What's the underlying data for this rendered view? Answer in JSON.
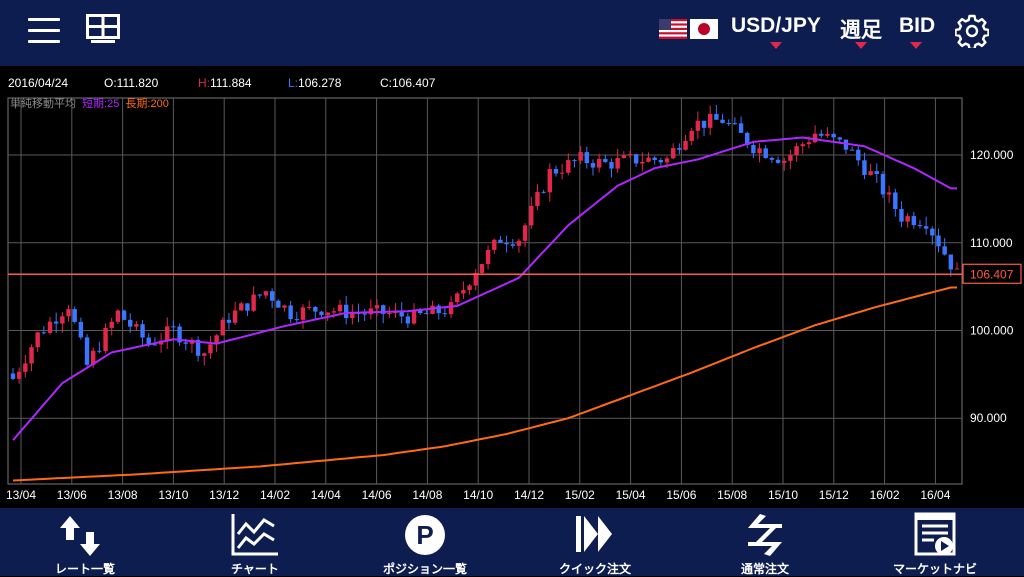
{
  "toolbar": {
    "pair": "USD/JPY",
    "period": "週足",
    "price_type": "BID",
    "flags": [
      "us-flag-icon",
      "jp-flag-icon"
    ]
  },
  "ohlc": {
    "date": "2016/04/24",
    "open": "O:111.820",
    "high_prefix": "H:",
    "high_value": "111.884",
    "low_prefix": "L:",
    "low_value": "106.278",
    "close": "C:106.407"
  },
  "indicator": {
    "name": "単純移動平均",
    "short": "短期:25",
    "long": "長期:200"
  },
  "colors": {
    "up": "#e2284a",
    "down": "#3a76ff",
    "short_ma": "#b026ff",
    "long_ma": "#ff6a14",
    "current_line": "#ff5a45"
  },
  "bottom_nav": [
    {
      "label": "レート一覧",
      "icon": "rate-list-icon"
    },
    {
      "label": "チャート",
      "icon": "chart-icon"
    },
    {
      "label": "ポジション一覧",
      "icon": "position-icon"
    },
    {
      "label": "クイック注文",
      "icon": "quick-order-icon"
    },
    {
      "label": "通常注文",
      "icon": "normal-order-icon"
    },
    {
      "label": "マーケットナビ",
      "icon": "market-navi-icon"
    }
  ],
  "chart_data": {
    "type": "candlestick",
    "title": "",
    "x_labels": [
      "13/04",
      "13/06",
      "13/08",
      "13/10",
      "13/12",
      "14/02",
      "14/04",
      "14/06",
      "14/08",
      "14/10",
      "14/12",
      "15/02",
      "15/04",
      "15/06",
      "15/08",
      "15/10",
      "15/12",
      "16/02",
      "16/04"
    ],
    "y_ticks": [
      "90.000",
      "100.000",
      "110.000",
      "120.000"
    ],
    "ylim": [
      82.5,
      126.5
    ],
    "current_price": "106.407",
    "current_value": 106.407,
    "grid": true,
    "close_path": [
      [
        0,
        94.5
      ],
      [
        4,
        99.5
      ],
      [
        9,
        103
      ],
      [
        12,
        96
      ],
      [
        17,
        102
      ],
      [
        22,
        98.5
      ],
      [
        26,
        100
      ],
      [
        31,
        97.5
      ],
      [
        35,
        101.5
      ],
      [
        41,
        104.5
      ],
      [
        45,
        102
      ],
      [
        50,
        102.5
      ],
      [
        55,
        102
      ],
      [
        60,
        102
      ],
      [
        65,
        101.5
      ],
      [
        71,
        102.5
      ],
      [
        75,
        107
      ],
      [
        79,
        110.5
      ],
      [
        82,
        110.5
      ],
      [
        87,
        118
      ],
      [
        92,
        119.5
      ],
      [
        96,
        119
      ],
      [
        101,
        119.5
      ],
      [
        106,
        119.5
      ],
      [
        110,
        123.5
      ],
      [
        115,
        124
      ],
      [
        120,
        121
      ],
      [
        125,
        119.5
      ],
      [
        130,
        122.5
      ],
      [
        135,
        121
      ],
      [
        140,
        117
      ],
      [
        144,
        113
      ],
      [
        148,
        112.5
      ],
      [
        153,
        106.4
      ]
    ],
    "short_ma": [
      [
        0,
        87.5
      ],
      [
        8,
        94
      ],
      [
        16,
        97.5
      ],
      [
        26,
        99
      ],
      [
        33,
        98.5
      ],
      [
        44,
        100.5
      ],
      [
        54,
        102
      ],
      [
        64,
        102.2
      ],
      [
        72,
        102.8
      ],
      [
        82,
        106
      ],
      [
        90,
        112
      ],
      [
        98,
        116.5
      ],
      [
        104,
        118.5
      ],
      [
        111,
        119.5
      ],
      [
        120,
        121.5
      ],
      [
        128,
        122
      ],
      [
        138,
        121
      ],
      [
        146,
        118.5
      ],
      [
        152,
        116.2
      ]
    ],
    "long_ma": [
      [
        0,
        82.9
      ],
      [
        20,
        83.6
      ],
      [
        40,
        84.5
      ],
      [
        60,
        85.8
      ],
      [
        70,
        86.8
      ],
      [
        80,
        88.2
      ],
      [
        90,
        90
      ],
      [
        100,
        92.6
      ],
      [
        110,
        95.2
      ],
      [
        120,
        98
      ],
      [
        130,
        100.6
      ],
      [
        140,
        102.7
      ],
      [
        152,
        104.9
      ]
    ]
  }
}
